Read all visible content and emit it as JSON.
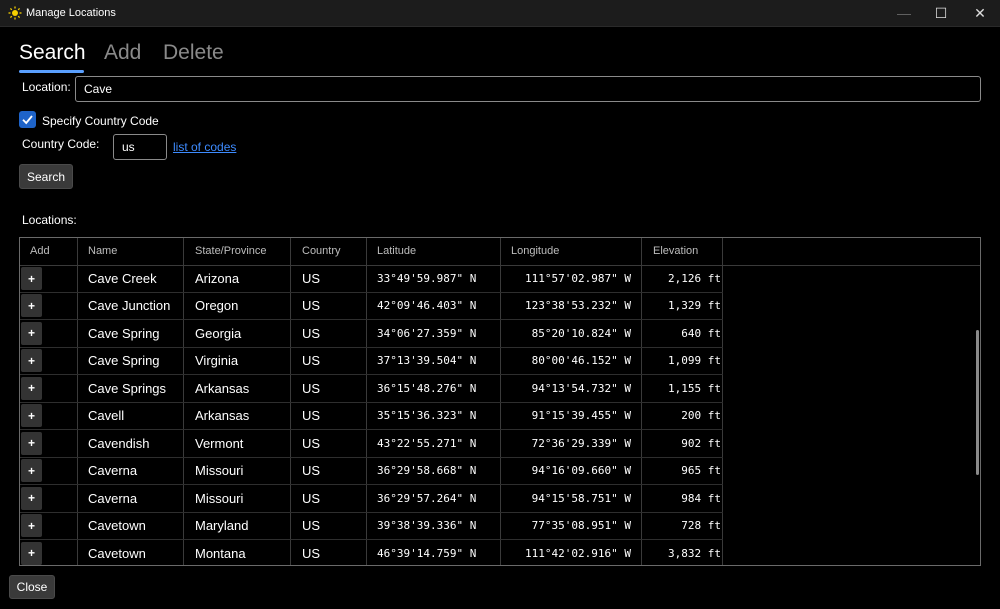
{
  "window": {
    "title": "Manage Locations",
    "icon": "sun-icon",
    "controls": {
      "minimize": "—",
      "maximize": "☐",
      "close": "✕"
    }
  },
  "tabs": [
    {
      "label": "Search",
      "active": true
    },
    {
      "label": "Add",
      "active": false
    },
    {
      "label": "Delete",
      "active": false
    }
  ],
  "search": {
    "location_label": "Location:",
    "location_value": "Cave",
    "specify_country_label": "Specify Country Code",
    "specify_country_checked": true,
    "check_glyph": "✓",
    "country_code_label": "Country Code:",
    "country_code_value": "us",
    "list_link": "list of codes",
    "search_button": "Search"
  },
  "locations_label": "Locations:",
  "table": {
    "columns": [
      "Add",
      "Name",
      "State/Province",
      "Country",
      "Latitude",
      "Longitude",
      "Elevation"
    ],
    "add_glyph": "+",
    "rows": [
      {
        "name": "Cave Creek",
        "state": "Arizona",
        "country": "US",
        "lat": "33°49'59.987\" N",
        "lon": "111°57'02.987\" W",
        "elev": "2,126 ft"
      },
      {
        "name": "Cave Junction",
        "state": "Oregon",
        "country": "US",
        "lat": "42°09'46.403\" N",
        "lon": "123°38'53.232\" W",
        "elev": "1,329 ft"
      },
      {
        "name": "Cave Spring",
        "state": "Georgia",
        "country": "US",
        "lat": "34°06'27.359\" N",
        "lon": "85°20'10.824\" W",
        "elev": "640 ft"
      },
      {
        "name": "Cave Spring",
        "state": "Virginia",
        "country": "US",
        "lat": "37°13'39.504\" N",
        "lon": "80°00'46.152\" W",
        "elev": "1,099 ft"
      },
      {
        "name": "Cave Springs",
        "state": "Arkansas",
        "country": "US",
        "lat": "36°15'48.276\" N",
        "lon": "94°13'54.732\" W",
        "elev": "1,155 ft"
      },
      {
        "name": "Cavell",
        "state": "Arkansas",
        "country": "US",
        "lat": "35°15'36.323\" N",
        "lon": "91°15'39.455\" W",
        "elev": "200 ft"
      },
      {
        "name": "Cavendish",
        "state": "Vermont",
        "country": "US",
        "lat": "43°22'55.271\" N",
        "lon": "72°36'29.339\" W",
        "elev": "902 ft"
      },
      {
        "name": "Caverna",
        "state": "Missouri",
        "country": "US",
        "lat": "36°29'58.668\" N",
        "lon": "94°16'09.660\" W",
        "elev": "965 ft"
      },
      {
        "name": "Caverna",
        "state": "Missouri",
        "country": "US",
        "lat": "36°29'57.264\" N",
        "lon": "94°15'58.751\" W",
        "elev": "984 ft"
      },
      {
        "name": "Cavetown",
        "state": "Maryland",
        "country": "US",
        "lat": "39°38'39.336\" N",
        "lon": "77°35'08.951\" W",
        "elev": "728 ft"
      },
      {
        "name": "Cavetown",
        "state": "Montana",
        "country": "US",
        "lat": "46°39'14.759\" N",
        "lon": "111°42'02.916\" W",
        "elev": "3,832 ft"
      }
    ]
  },
  "close_button": "Close",
  "colors": {
    "accent": "#1e63c8",
    "link": "#3d8bff",
    "tab_underline": "#5aa0ff"
  }
}
